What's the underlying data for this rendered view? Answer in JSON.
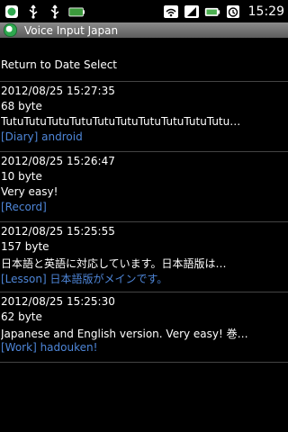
{
  "status_bar": {
    "time": "15:29",
    "icons": [
      "notification-android-icon",
      "usb-icon",
      "usb-debug-icon",
      "battery-full-icon",
      "wifi-icon",
      "signal-icon",
      "battery-status-icon",
      "alarm-icon"
    ]
  },
  "title_bar": {
    "title": "Voice Input Japan"
  },
  "return": {
    "label": "Return to Date Select"
  },
  "entries": [
    {
      "datetime": "2012/08/25 15:27:35",
      "size": "68 byte",
      "text": "TutuTutuTutuTutuTutuTutuTutuTutuTutuTutu…",
      "tag": "[Diary] android"
    },
    {
      "datetime": "2012/08/25 15:26:47",
      "size": "10 byte",
      "text": "Very easy!",
      "tag": "[Record]"
    },
    {
      "datetime": "2012/08/25 15:25:55",
      "size": "157 byte",
      "text": "日本語と英語に対応しています。日本語版は…",
      "tag": "[Lesson] 日本語版がメインです。"
    },
    {
      "datetime": "2012/08/25 15:25:30",
      "size": "62 byte",
      "text": "Japanese and English version. Very easy! 巻…",
      "tag": "[Work] hadouken!"
    }
  ]
}
